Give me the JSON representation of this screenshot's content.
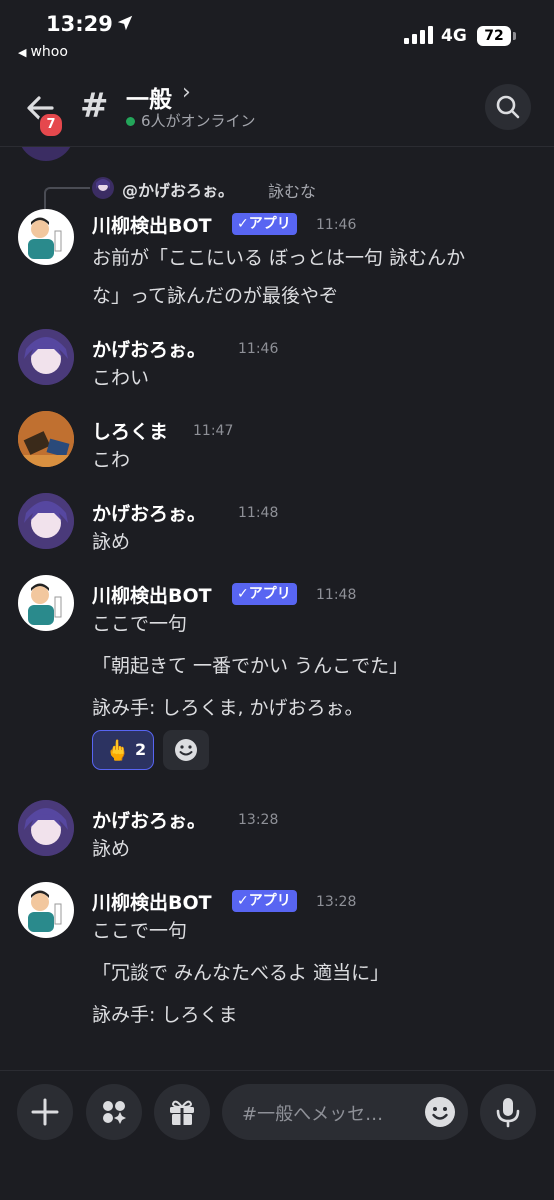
{
  "status_bar": {
    "time": "13:29",
    "back_app": "whoo",
    "network": "4G",
    "battery": "72"
  },
  "header": {
    "notification_count": "7",
    "channel_name": "一般",
    "online_text": "6人がオンライン"
  },
  "reply": {
    "name": "@かげおろぉ。",
    "text": "詠むな"
  },
  "messages": [
    {
      "author": "川柳検出BOT",
      "tag": "✓アプリ",
      "time": "11:46",
      "lines": [
        "お前が「ここにいる ぼっとは一句 詠むんか",
        "な」って詠んだのが最後やぞ"
      ]
    },
    {
      "author": "かげおろぉ。",
      "time": "11:46",
      "lines": [
        "こわい"
      ]
    },
    {
      "author": "しろくま",
      "time": "11:47",
      "lines": [
        "こわ"
      ]
    },
    {
      "author": "かげおろぉ。",
      "time": "11:48",
      "lines": [
        "詠め"
      ]
    },
    {
      "author": "川柳検出BOT",
      "tag": "✓アプリ",
      "time": "11:48",
      "lines": [
        "ここで一句",
        "「朝起きて 一番でかい うんこでた」",
        "詠み手: しろくま, かげおろぉ。"
      ],
      "reaction": {
        "emoji": "🖕",
        "count": "2"
      }
    },
    {
      "author": "かげおろぉ。",
      "time": "13:28",
      "lines": [
        "詠め"
      ]
    },
    {
      "author": "川柳検出BOT",
      "tag": "✓アプリ",
      "time": "13:28",
      "lines": [
        "ここで一句",
        "「冗談で みんなたべるよ 適当に」",
        "詠み手: しろくま"
      ]
    }
  ],
  "composer": {
    "placeholder": "#一般へメッセ…"
  },
  "colors": {
    "background": "#1c1d22",
    "app_tag": "#5865f2",
    "online_dot": "#23a55a",
    "badge": "#e5484d"
  }
}
